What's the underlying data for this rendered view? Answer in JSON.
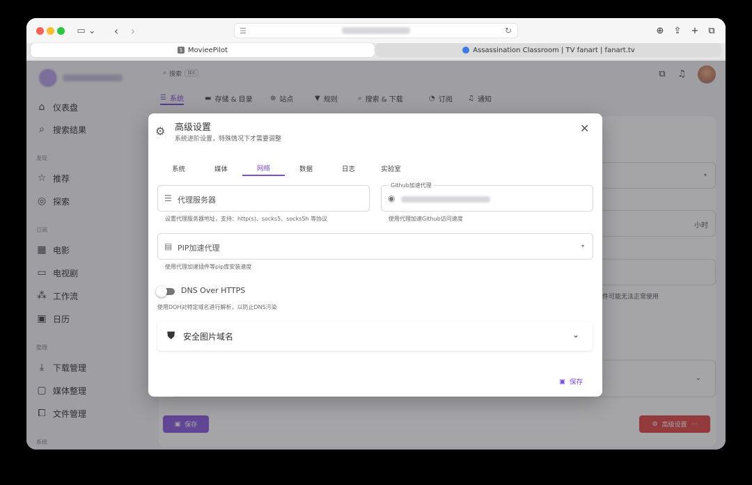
{
  "browser": {
    "tabs": [
      {
        "label": "MovieePilot",
        "favicon": "1"
      },
      {
        "label": "Assassination Classroom | TV fanart | fanart.tv"
      }
    ]
  },
  "app": {
    "search": {
      "placeholder": "搜索",
      "shortcut": "⌘K"
    },
    "sidebar": {
      "items": [
        {
          "label": "仪表盘"
        },
        {
          "label": "搜索结果"
        },
        {
          "label": "推荐"
        },
        {
          "label": "探索"
        },
        {
          "label": "电影"
        },
        {
          "label": "电视剧"
        },
        {
          "label": "工作流"
        },
        {
          "label": "日历"
        },
        {
          "label": "下载管理"
        },
        {
          "label": "媒体整理"
        },
        {
          "label": "文件管理"
        }
      ],
      "sections": [
        "发现",
        "订阅",
        "整理",
        "系统"
      ]
    },
    "main_tabs": [
      {
        "label": "系统"
      },
      {
        "label": "存储 & 目录"
      },
      {
        "label": "站点"
      },
      {
        "label": "规则"
      },
      {
        "label": "搜索 & 下载"
      },
      {
        "label": "订阅"
      },
      {
        "label": "通知"
      }
    ],
    "background": {
      "hours_suffix": "小时",
      "plugin_hint": "插件可能无法正常使用",
      "save_label": "保存",
      "advanced_label": "高级设置"
    }
  },
  "dialog": {
    "title": "高级设置",
    "subtitle": "系统进阶设置，特殊情况下才需要调整",
    "tabs": [
      {
        "label": "系统"
      },
      {
        "label": "媒体"
      },
      {
        "label": "网络"
      },
      {
        "label": "数据"
      },
      {
        "label": "日志"
      },
      {
        "label": "实验室"
      }
    ],
    "proxy": {
      "placeholder": "代理服务器",
      "hint": "设置代理服务器地址，支持：http(s)、socks5、socks5h 等协议"
    },
    "github_proxy": {
      "legend": "Github加速代理",
      "hint": "使用代理加速Github访问速度"
    },
    "pip_proxy": {
      "placeholder": "PIP加速代理",
      "hint": "使用代理加速插件等pip库安装速度"
    },
    "doh": {
      "label": "DNS Over HTTPS",
      "hint": "使用DOH对特定域名进行解析，以防止DNS污染",
      "enabled": false
    },
    "secure_image": {
      "label": "安全图片域名"
    },
    "save_label": "保存"
  },
  "colors": {
    "accent": "#7b4bd6",
    "danger": "#e04848"
  }
}
